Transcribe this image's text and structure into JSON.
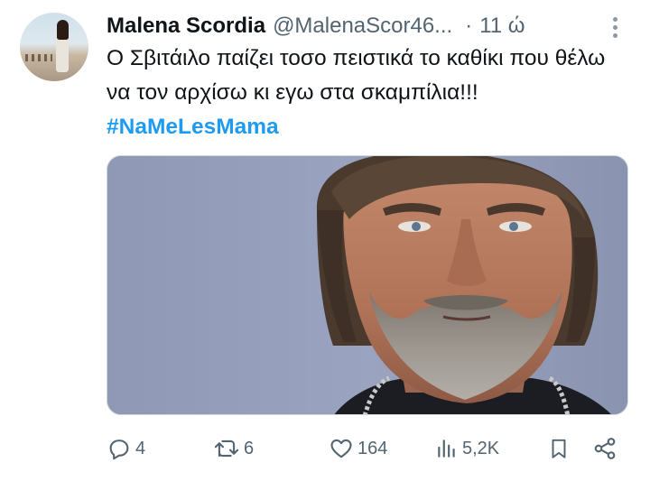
{
  "author": {
    "display_name": "Malena Scordia",
    "handle": "@MalenaScor46...",
    "separator": "·",
    "time": "11 ώ"
  },
  "tweet": {
    "text": "Ο Σβιτάιλο παίζει τοσο πειστικά το καθίκι που θέλω να τον αρχίσω κι εγω στα σκαμπίλια!!!",
    "hashtag": "#NaMeLesMama"
  },
  "actions": {
    "reply_count": "4",
    "retweet_count": "6",
    "like_count": "164",
    "views_count": "5,2K"
  },
  "icons": {
    "reply": "reply-icon",
    "retweet": "retweet-icon",
    "like": "heart-icon",
    "views": "views-icon",
    "bookmark": "bookmark-icon",
    "share": "share-icon",
    "more": "more-vertical-icon"
  },
  "colors": {
    "text": "#0f1419",
    "secondary": "#536471",
    "link": "#1d9bf0"
  }
}
